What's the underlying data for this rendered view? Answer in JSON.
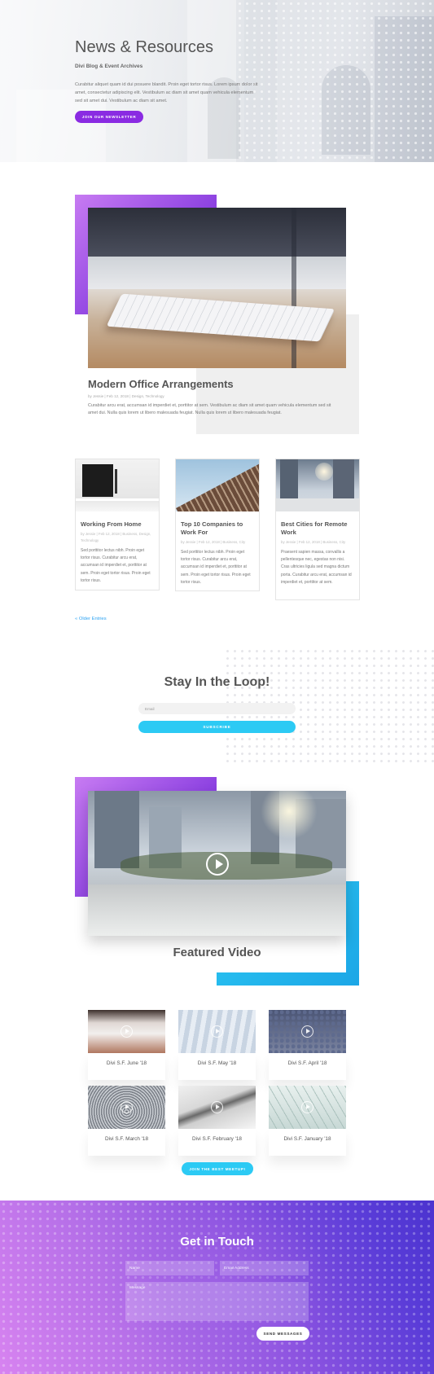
{
  "hero": {
    "title": "News & Resources",
    "subtitle": "Divi Blog & Event Archives",
    "body": "Curabitur aliquet quam id dui posuere blandit. Proin eget tortor risus. Lorem ipsum dolor sit amet, consectetur adipiscing elit. Vestibulum ac diam sit amet quam vehicula elementum sed sit amet dui. Vestibulum ac diam sit amet.",
    "button": "JOIN OUR NEWSLETTER"
  },
  "featured_post": {
    "title": "Modern Office Arrangements",
    "meta": "by Jessie | Feb 12, 2018 | Design, Technology",
    "excerpt": "Curabitur arcu erat, accumsan id imperdiet et, porttitor at sem. Vestibulum ac diam sit amet quam vehicula elementum sed sit amet dui. Nulla quis lorem ut libero malesuada feugiat. Nulla quis lorem ut libero malesuada feugiat."
  },
  "posts": [
    {
      "title": "Working From Home",
      "meta": "by Jessie | Feb 12, 2018 | Business, Design, Technology",
      "excerpt": "Sed porttitor lectus nibh. Proin eget tortor risus. Curabitur arcu erat, accumsan id imperdiet et, porttitor at sem. Proin eget tortor risus. Proin eget tortor risus."
    },
    {
      "title": "Top 10 Companies to Work For",
      "meta": "by Jessie | Feb 12, 2018 | Business, City",
      "excerpt": "Sed porttitor lectus nibh. Proin eget tortor risus. Curabitur arcu erat, accumsan id imperdiet et, porttitor at sem. Proin eget tortor risus. Proin eget tortor risus."
    },
    {
      "title": "Best Cities for Remote Work",
      "meta": "by Jessie | Feb 12, 2018 | Business, City",
      "excerpt": "Praesent sapien massa, convallis a pellentesque nec, egestas non nisi. Cras ultricies ligula sed magna dictum porta. Curabitur arcu erat, accumsan id imperdiet et, porttitor at sem."
    }
  ],
  "pagination": {
    "older": "« Older Entries"
  },
  "newsletter": {
    "title": "Stay In the Loop!",
    "email_placeholder": "Email",
    "button": "SUBSCRIBE"
  },
  "featured_video": {
    "title": "Featured Video"
  },
  "videos": [
    {
      "label": "Divi S.F. June '18"
    },
    {
      "label": "Divi S.F. May '18"
    },
    {
      "label": "Divi S.F. April '18"
    },
    {
      "label": "Divi S.F. March '18"
    },
    {
      "label": "Divi S.F. February '18"
    },
    {
      "label": "Divi S.F. January '18"
    }
  ],
  "meetup_button": "JOIN THE BEST MEETUP!",
  "contact": {
    "title": "Get in Touch",
    "name_placeholder": "Name",
    "email_placeholder": "Email Address",
    "message_placeholder": "Message",
    "button": "SEND MESSAGES"
  },
  "colors": {
    "purple": "#8a2be2",
    "cyan": "#2ccaf4",
    "link": "#2ea3f2"
  }
}
